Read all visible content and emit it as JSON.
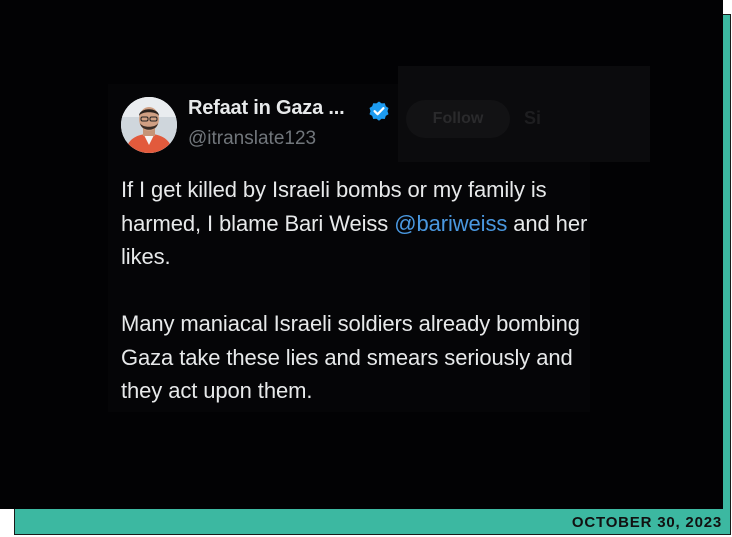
{
  "tweet": {
    "display_name": "Refaat in Gaza ...",
    "handle": "@itranslate123",
    "follow_label": "Follow",
    "menu_label": "Si",
    "paragraph_1_before": "If I get killed by Israeli bombs or my family is harmed, I blame Bari Weiss ",
    "mention": "@bariweiss",
    "paragraph_1_after": " and her likes.",
    "paragraph_2": "Many maniacal Israeli soldiers already bombing Gaza take these lies and smears seriously and they act upon them.",
    "verified_icon": "verified-badge-icon"
  },
  "footer": {
    "date": "OCTOBER 30, 2023"
  },
  "colors": {
    "background": "#020204",
    "accent_teal": "#3cb8a1",
    "text_primary": "#e7e9ea",
    "text_secondary": "#71767b",
    "link_blue": "#4a98e0",
    "verified_blue": "#1d9bf0"
  }
}
